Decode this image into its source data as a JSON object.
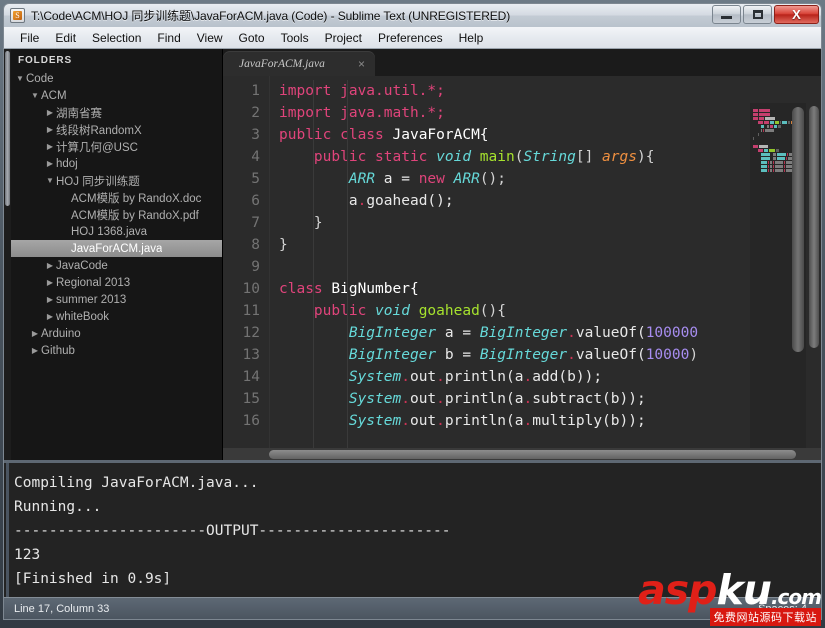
{
  "window": {
    "title": "T:\\Code\\ACM\\HOJ 同步训练题\\JavaForACM.java (Code) - Sublime Text (UNREGISTERED)",
    "icon": "sublime-text-icon",
    "buttons": {
      "minimize": "minimize-button",
      "maximize": "maximize-button",
      "close": "close-button",
      "close_label": "X"
    }
  },
  "menubar": {
    "items": [
      "File",
      "Edit",
      "Selection",
      "Find",
      "View",
      "Goto",
      "Tools",
      "Project",
      "Preferences",
      "Help"
    ]
  },
  "sidebar": {
    "header": "FOLDERS",
    "items": [
      {
        "label": "Code",
        "indent": 0,
        "arrow": "▼",
        "selected": false
      },
      {
        "label": "ACM",
        "indent": 1,
        "arrow": "▼",
        "selected": false
      },
      {
        "label": "湖南省赛",
        "indent": 2,
        "arrow": "▶",
        "selected": false
      },
      {
        "label": "线段树RandomX",
        "indent": 2,
        "arrow": "▶",
        "selected": false
      },
      {
        "label": "计算几何@USC",
        "indent": 2,
        "arrow": "▶",
        "selected": false
      },
      {
        "label": "hdoj",
        "indent": 2,
        "arrow": "▶",
        "selected": false
      },
      {
        "label": "HOJ 同步训练题",
        "indent": 2,
        "arrow": "▼",
        "selected": false
      },
      {
        "label": "ACM模版 by RandoX.doc",
        "indent": 3,
        "arrow": "",
        "selected": false
      },
      {
        "label": "ACM模版 by RandoX.pdf",
        "indent": 3,
        "arrow": "",
        "selected": false
      },
      {
        "label": "HOJ 1368.java",
        "indent": 3,
        "arrow": "",
        "selected": false
      },
      {
        "label": "JavaForACM.java",
        "indent": 3,
        "arrow": "",
        "selected": true
      },
      {
        "label": "JavaCode",
        "indent": 2,
        "arrow": "▶",
        "selected": false
      },
      {
        "label": "Regional 2013",
        "indent": 2,
        "arrow": "▶",
        "selected": false
      },
      {
        "label": "summer 2013",
        "indent": 2,
        "arrow": "▶",
        "selected": false
      },
      {
        "label": "whiteBook",
        "indent": 2,
        "arrow": "▶",
        "selected": false
      },
      {
        "label": "Arduino",
        "indent": 1,
        "arrow": "▶",
        "selected": false
      },
      {
        "label": "Github",
        "indent": 1,
        "arrow": "▶",
        "selected": false
      }
    ]
  },
  "editor": {
    "tabs": [
      {
        "label": "JavaForACM.java",
        "close": "×",
        "active": true
      }
    ],
    "line_numbers": [
      "1",
      "2",
      "3",
      "4",
      "5",
      "6",
      "7",
      "8",
      "9",
      "10",
      "11",
      "12",
      "13",
      "14",
      "15",
      "16"
    ],
    "lines": [
      {
        "n": "1",
        "tokens": [
          {
            "t": "import ",
            "c": "t-kw"
          },
          {
            "t": "java.util.*;",
            "c": "t-kw"
          }
        ]
      },
      {
        "n": "2",
        "tokens": [
          {
            "t": "import ",
            "c": "t-kw"
          },
          {
            "t": "java.math.*;",
            "c": "t-kw"
          }
        ]
      },
      {
        "n": "3",
        "tokens": [
          {
            "t": "public ",
            "c": "t-kw"
          },
          {
            "t": "class ",
            "c": "t-kw"
          },
          {
            "t": "JavaForACM{",
            "c": "t-cls"
          }
        ]
      },
      {
        "n": "4",
        "tokens": [
          {
            "t": "    ",
            "c": "t-pun"
          },
          {
            "t": "public ",
            "c": "t-kw"
          },
          {
            "t": "static ",
            "c": "t-kw"
          },
          {
            "t": "void ",
            "c": "t-ty"
          },
          {
            "t": "main",
            "c": "t-fn"
          },
          {
            "t": "(",
            "c": "t-pun"
          },
          {
            "t": "String",
            "c": "t-ty"
          },
          {
            "t": "[] ",
            "c": "t-pun"
          },
          {
            "t": "args",
            "c": "t-param"
          },
          {
            "t": "){",
            "c": "t-pun"
          }
        ]
      },
      {
        "n": "5",
        "tokens": [
          {
            "t": "        ",
            "c": "t-pun"
          },
          {
            "t": "ARR",
            "c": "t-ty"
          },
          {
            "t": " a = ",
            "c": "t-var"
          },
          {
            "t": "new ",
            "c": "t-kw"
          },
          {
            "t": "ARR",
            "c": "t-ty"
          },
          {
            "t": "();",
            "c": "t-pun"
          }
        ]
      },
      {
        "n": "6",
        "tokens": [
          {
            "t": "        a",
            "c": "t-var"
          },
          {
            "t": ".",
            "c": "t-dot"
          },
          {
            "t": "goahead();",
            "c": "t-var"
          }
        ]
      },
      {
        "n": "7",
        "tokens": [
          {
            "t": "    }",
            "c": "t-pun"
          }
        ]
      },
      {
        "n": "8",
        "tokens": [
          {
            "t": "}",
            "c": "t-pun"
          }
        ]
      },
      {
        "n": "9",
        "tokens": [
          {
            "t": "",
            "c": "t-pun"
          }
        ]
      },
      {
        "n": "10",
        "tokens": [
          {
            "t": "class ",
            "c": "t-kw"
          },
          {
            "t": "BigNumber{",
            "c": "t-cls"
          }
        ]
      },
      {
        "n": "11",
        "tokens": [
          {
            "t": "    ",
            "c": "t-pun"
          },
          {
            "t": "public ",
            "c": "t-kw"
          },
          {
            "t": "void ",
            "c": "t-ty"
          },
          {
            "t": "goahead",
            "c": "t-fn"
          },
          {
            "t": "(){",
            "c": "t-pun"
          }
        ]
      },
      {
        "n": "12",
        "tokens": [
          {
            "t": "        ",
            "c": "t-pun"
          },
          {
            "t": "BigInteger",
            "c": "t-ty"
          },
          {
            "t": " a = ",
            "c": "t-var"
          },
          {
            "t": "BigInteger",
            "c": "t-ty"
          },
          {
            "t": ".",
            "c": "t-dot"
          },
          {
            "t": "valueOf(",
            "c": "t-var"
          },
          {
            "t": "100000",
            "c": "t-num"
          }
        ]
      },
      {
        "n": "13",
        "tokens": [
          {
            "t": "        ",
            "c": "t-pun"
          },
          {
            "t": "BigInteger",
            "c": "t-ty"
          },
          {
            "t": " b = ",
            "c": "t-var"
          },
          {
            "t": "BigInteger",
            "c": "t-ty"
          },
          {
            "t": ".",
            "c": "t-dot"
          },
          {
            "t": "valueOf(",
            "c": "t-var"
          },
          {
            "t": "10000",
            "c": "t-num"
          },
          {
            "t": ")",
            "c": "t-pun"
          }
        ]
      },
      {
        "n": "14",
        "tokens": [
          {
            "t": "        ",
            "c": "t-pun"
          },
          {
            "t": "System",
            "c": "t-ty"
          },
          {
            "t": ".",
            "c": "t-dot"
          },
          {
            "t": "out",
            "c": "t-var"
          },
          {
            "t": ".",
            "c": "t-dot"
          },
          {
            "t": "println(a",
            "c": "t-var"
          },
          {
            "t": ".",
            "c": "t-dot"
          },
          {
            "t": "add(b));",
            "c": "t-var"
          }
        ]
      },
      {
        "n": "15",
        "tokens": [
          {
            "t": "        ",
            "c": "t-pun"
          },
          {
            "t": "System",
            "c": "t-ty"
          },
          {
            "t": ".",
            "c": "t-dot"
          },
          {
            "t": "out",
            "c": "t-var"
          },
          {
            "t": ".",
            "c": "t-dot"
          },
          {
            "t": "println(a",
            "c": "t-var"
          },
          {
            "t": ".",
            "c": "t-dot"
          },
          {
            "t": "subtract(b));",
            "c": "t-var"
          }
        ]
      },
      {
        "n": "16",
        "tokens": [
          {
            "t": "        ",
            "c": "t-pun"
          },
          {
            "t": "System",
            "c": "t-ty"
          },
          {
            "t": ".",
            "c": "t-dot"
          },
          {
            "t": "out",
            "c": "t-var"
          },
          {
            "t": ".",
            "c": "t-dot"
          },
          {
            "t": "println(a",
            "c": "t-var"
          },
          {
            "t": ".",
            "c": "t-dot"
          },
          {
            "t": "multiply(b));",
            "c": "t-var"
          }
        ]
      }
    ]
  },
  "console": {
    "lines": [
      "Compiling JavaForACM.java...",
      "Running...",
      "----------------------OUTPUT----------------------",
      "123",
      "[Finished in 0.9s]"
    ]
  },
  "statusbar": {
    "position": "Line 17, Column 33",
    "indentation": "Spaces: 4"
  },
  "watermark": {
    "part_a": "asp",
    "part_b": "ku",
    "suffix": ".com",
    "subtitle": "免费网站源码下载站"
  },
  "colors": {
    "keyword": "#e0447b",
    "type": "#66d9d9",
    "function": "#a6e22e",
    "number": "#a78df0",
    "param": "#f09040",
    "editor_bg": "#2b2b2b",
    "sidebar_bg": "#161616",
    "console_bg": "#232323",
    "accent_close": "#d9453a"
  }
}
